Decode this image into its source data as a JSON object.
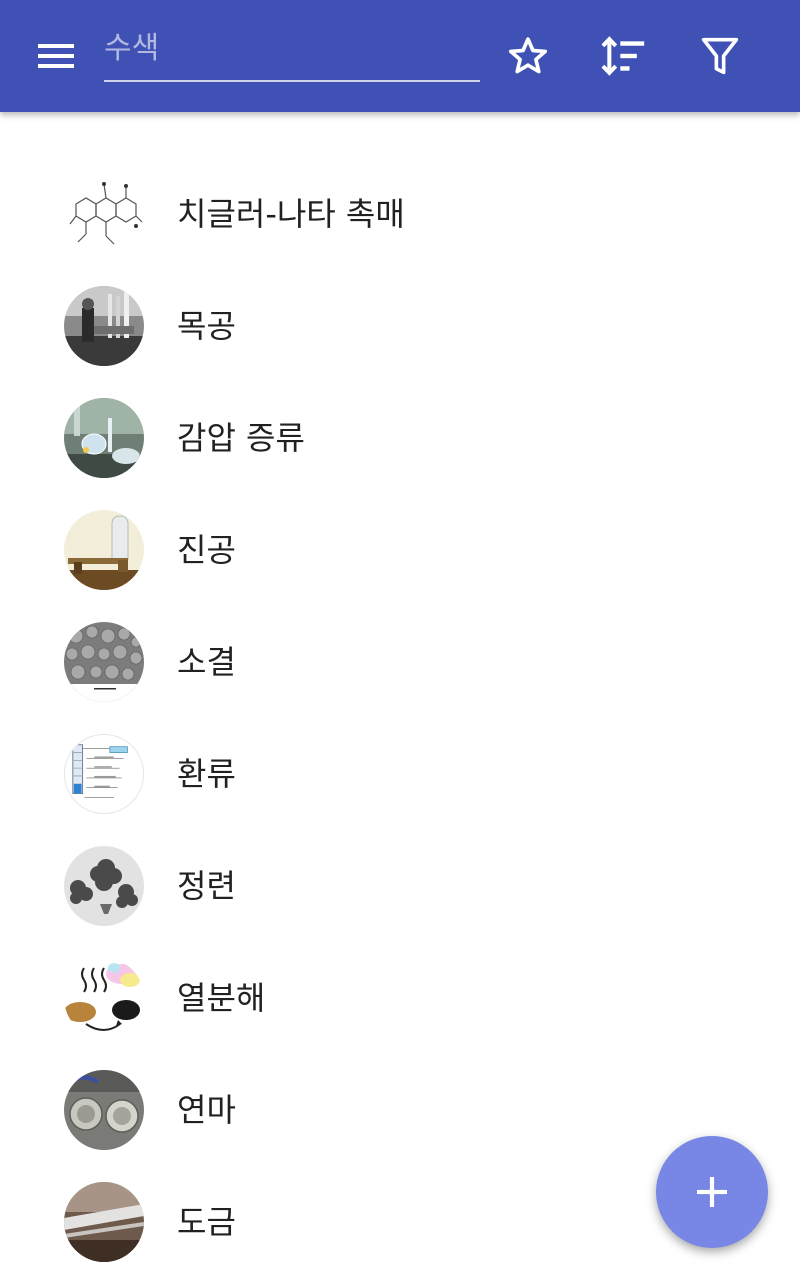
{
  "toolbar": {
    "background": "#3f51b5",
    "search_placeholder": "수색",
    "search_value": "",
    "icons": [
      "menu-icon",
      "star-outline-icon",
      "sort-icon",
      "filter-icon"
    ]
  },
  "list": {
    "items": [
      {
        "label": "치글러-나타 촉매",
        "icon": "chemical-structure-thumbnail"
      },
      {
        "label": "목공",
        "icon": "woodworking-photo-thumbnail"
      },
      {
        "label": "감압 증류",
        "icon": "vacuum-distillation-photo-thumbnail"
      },
      {
        "label": "진공",
        "icon": "vacuum-pump-photo-thumbnail"
      },
      {
        "label": "소결",
        "icon": "sinter-pellets-photo-thumbnail"
      },
      {
        "label": "환류",
        "icon": "reflux-diagram-thumbnail"
      },
      {
        "label": "정련",
        "icon": "refined-metal-photo-thumbnail"
      },
      {
        "label": "열분해",
        "icon": "pyrolysis-diagram-thumbnail"
      },
      {
        "label": "연마",
        "icon": "polishing-photo-thumbnail"
      },
      {
        "label": "도금",
        "icon": "plating-photo-thumbnail"
      }
    ]
  },
  "fab": {
    "icon": "plus-icon",
    "color": "#7886e6"
  }
}
